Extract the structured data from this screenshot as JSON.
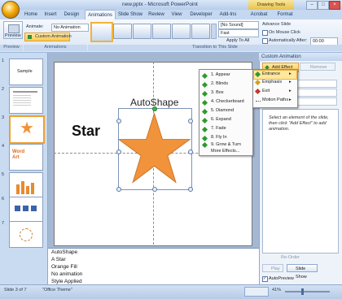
{
  "window": {
    "title": "new.pptx - Microsoft PowerPoint",
    "context_tab": "Drawing Tools"
  },
  "tabs": [
    "Home",
    "Insert",
    "Design",
    "Animations",
    "Slide Show",
    "Review",
    "View",
    "Developer",
    "Add-Ins",
    "Acrobat",
    "Format"
  ],
  "active_tab": "Animations",
  "ribbon": {
    "preview_label": "Preview",
    "animate_label": "Animate:",
    "animate_value": "No Animation",
    "custom_animation_label": "Custom Animation",
    "sound_value": "[No Sound]",
    "speed_value": "Fast",
    "apply_to_all": "Apply To All",
    "advance_slide": "Advance Slide",
    "on_mouse_click": "On Mouse Click",
    "auto_after": "Automatically After:",
    "auto_time": "00:00",
    "groups": {
      "preview": "Preview",
      "animations": "Animations",
      "transition": "Transition to This Slide"
    }
  },
  "slides_pane": {
    "thumbs": [
      {
        "num": "1",
        "text": "Sample"
      },
      {
        "num": "2",
        "text": ""
      },
      {
        "num": "3",
        "text": ""
      },
      {
        "num": "4",
        "text": "Word Art"
      },
      {
        "num": "5",
        "text": ""
      },
      {
        "num": "6",
        "text": ""
      },
      {
        "num": "7",
        "text": ""
      }
    ]
  },
  "slide": {
    "shape_label": "AutoShape",
    "star_label": "Star",
    "star_color": "#f0933a"
  },
  "notes": {
    "lines": [
      "AutoShape",
      "A Star",
      "Orange Fill",
      "No animation",
      "Style Applied"
    ]
  },
  "task_pane": {
    "title": "Custom Animation",
    "add_effect": "Add Effect",
    "remove": "Remove",
    "hint": "Select an element of the slide, then click \"Add Effect\" to add animation.",
    "reorder": "Re-Order",
    "play": "Play",
    "slide_show": "Slide Show",
    "autopreview": "AutoPreview"
  },
  "effects_menu": {
    "items": [
      "1. Appear",
      "2. Blinds",
      "3. Box",
      "4. Checkerboard",
      "5. Diamond",
      "6. Expand",
      "7. Fade",
      "8. Fly In",
      "9. Grow & Turn"
    ],
    "more": "More Effects..."
  },
  "effect_submenu": {
    "items": [
      "Entrance",
      "Emphasis",
      "Exit",
      "Motion Paths"
    ]
  },
  "status": {
    "slide": "Slide 3 of 7",
    "theme": "\"Office Theme\"",
    "zoom": "41%"
  }
}
